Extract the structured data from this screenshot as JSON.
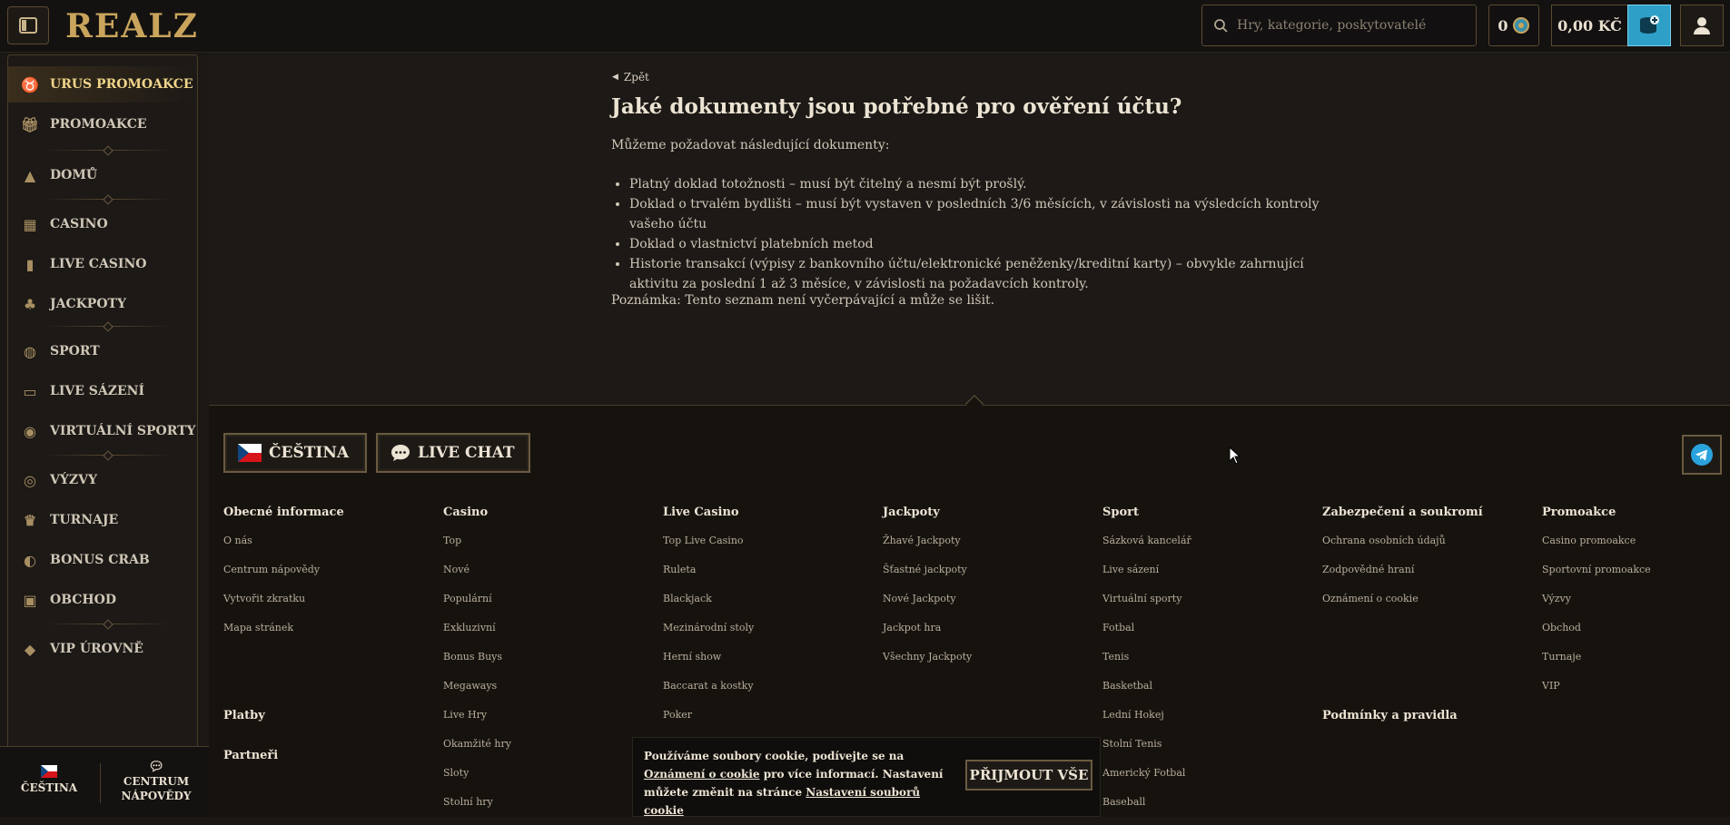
{
  "header": {
    "logo": "REALZ",
    "search_placeholder": "Hry, kategorie, poskytovatelé",
    "coins": "0",
    "balance": "0,00 KČ"
  },
  "sidebar": {
    "items": [
      {
        "label": "URUS PROMOAKCE",
        "icon": "bull-icon"
      },
      {
        "label": "PROMOAKCE",
        "icon": "gift-icon"
      },
      {
        "label": "DOMŮ",
        "icon": "pyramid-icon"
      },
      {
        "label": "CASINO",
        "icon": "slot-machine-icon"
      },
      {
        "label": "LIVE CASINO",
        "icon": "card-icon"
      },
      {
        "label": "JACKPOTY",
        "icon": "clover-icon"
      },
      {
        "label": "SPORT",
        "icon": "ball-icon"
      },
      {
        "label": "LIVE SÁZENÍ",
        "icon": "live-icon"
      },
      {
        "label": "VIRTUÁLNÍ SPORTY",
        "icon": "virtual-icon"
      },
      {
        "label": "VÝZVY",
        "icon": "target-icon"
      },
      {
        "label": "TURNAJE",
        "icon": "trophy-icon"
      },
      {
        "label": "BONUS CRAB",
        "icon": "crab-icon"
      },
      {
        "label": "OBCHOD",
        "icon": "shop-icon"
      },
      {
        "label": "VIP ÚROVNĚ",
        "icon": "diamond-icon"
      }
    ],
    "bottom": {
      "language": "ČEŠTINA",
      "help_line1": "CENTRUM",
      "help_line2": "NÁPOVĚDY"
    }
  },
  "article": {
    "back": "Zpět",
    "title": "Jaké dokumenty jsou potřebné pro ověření účtu?",
    "intro": "Můžeme požadovat následující dokumenty:",
    "items": [
      "Platný doklad totožnosti – musí být čitelný a nesmí být prošlý.",
      "Doklad o trvalém bydlišti – musí být vystaven v posledních 3/6 měsících, v závislosti na výsledcích kontroly vašeho účtu",
      "Doklad o vlastnictví platebních metod",
      "Historie transakcí (výpisy z bankovního účtu/elektronické peněženky/kreditní karty) – obvykle zahrnující aktivitu za poslední 1 až 3 měsíce, v závislosti na požadavcích kontroly."
    ],
    "note": "Poznámka: Tento seznam není vyčerpávající a může se lišit."
  },
  "footer": {
    "language_button": "ČEŠTINA",
    "chat_button": "LIVE CHAT",
    "columns": [
      {
        "title": "Obecné informace",
        "links": [
          "O nás",
          "Centrum nápovědy",
          "Vytvořit zkratku",
          "Mapa stránek"
        ]
      },
      {
        "title": "Casino",
        "links": [
          "Top",
          "Nové",
          "Populární",
          "Exkluzivní",
          "Bonus Buys",
          "Megaways",
          "Live Hry",
          "Okamžité hry",
          "Sloty",
          "Stolní hry"
        ]
      },
      {
        "title": "Live Casino",
        "links": [
          "Top Live Casino",
          "Ruleta",
          "Blackjack",
          "Mezinárodní stoly",
          "Herní show",
          "Baccarat a kostky",
          "Poker"
        ]
      },
      {
        "title": "Jackpoty",
        "links": [
          "Žhavé Jackpoty",
          "Šťastné jackpoty",
          "Nové Jackpoty",
          "Jackpot hra",
          "Všechny Jackpoty"
        ]
      },
      {
        "title": "Sport",
        "links": [
          "Sázková kancelář",
          "Live sázení",
          "Virtuální sporty",
          "Fotbal",
          "Tenis",
          "Basketbal",
          "Lední Hokej",
          "Stolní Tenis",
          "Americký Fotbal",
          "Baseball"
        ]
      },
      {
        "title": "Zabezpečení a soukromí",
        "links": [
          "Ochrana osobních údajů",
          "Zodpovědné hraní",
          "Oznámení o cookie"
        ]
      },
      {
        "title": "Promoakce",
        "links": [
          "Casino promoakce",
          "Sportovní promoakce",
          "Výzvy",
          "Obchod",
          "Turnaje",
          "VIP"
        ]
      }
    ],
    "platby": "Platby",
    "partneri": "Partneři",
    "podminky": "Podmínky a pravidla"
  },
  "cookie": {
    "text1": "Používáme soubory cookie, podívejte se na",
    "link1": "Oznámení o cookie",
    "text2": " pro více informací. Nastavení můžete změnit na stránce ",
    "link2": "Nastavení souborů cookie",
    "accept": "PŘIJMOUT VŠE"
  },
  "colors": {
    "accent_gold": "#c9a45c",
    "deposit_blue": "#2e9fc7",
    "background": "#1c1916"
  }
}
